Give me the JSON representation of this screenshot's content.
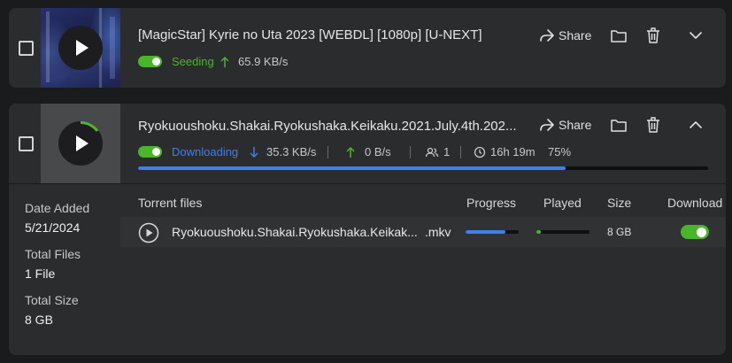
{
  "torrents": [
    {
      "title": "[MagicStar] Kyrie no Uta 2023 [WEBDL] [1080p] [U-NEXT]",
      "status": "Seeding",
      "upload_speed": "65.9 KB/s",
      "actions": {
        "share_label": "Share"
      },
      "expanded": false
    },
    {
      "title": "Ryokuoushoku.Shakai.Ryokushaka.Keikaku.2021.July.4th.202...",
      "status": "Downloading",
      "download_speed": "35.3 KB/s",
      "upload_speed": "0 B/s",
      "peers": "1",
      "eta": "16h 19m",
      "percent": "75%",
      "progress": 0.75,
      "actions": {
        "share_label": "Share"
      },
      "expanded": true,
      "details": {
        "date_added_label": "Date Added",
        "date_added": "5/21/2024",
        "total_files_label": "Total Files",
        "total_files": "1 File",
        "total_size_label": "Total Size",
        "total_size": "8 GB",
        "columns": {
          "files": "Torrent files",
          "progress": "Progress",
          "played": "Played",
          "size": "Size",
          "download": "Download"
        },
        "files": [
          {
            "name": "Ryokuoushoku.Shakai.Ryokushaka.Keikak...",
            "ext": ".mkv",
            "progress": 0.75,
            "played": 0.05,
            "size": "8 GB",
            "download_enabled": true
          }
        ]
      }
    }
  ],
  "colors": {
    "seeding": "#4cb52b",
    "downloading": "#3f7fe6",
    "card": "#2b2c2e",
    "background": "#1a1b1d"
  }
}
